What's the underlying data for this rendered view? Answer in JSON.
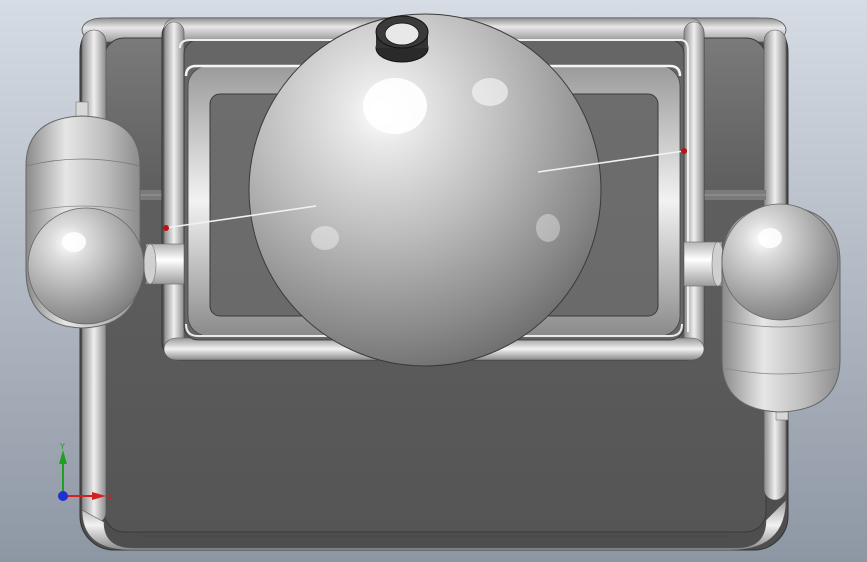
{
  "viewport": {
    "background_top": "#d4dae2",
    "background_bottom": "#8a93a0"
  },
  "triad": {
    "x_label": "X",
    "y_label": "Y",
    "x_color": "#d42020",
    "y_color": "#20a020",
    "z_color": "#2030d0"
  },
  "model": {
    "body_color": "#6a6a6a",
    "sphere_color": "#c8c8c8",
    "marker_color": "#c01010"
  }
}
